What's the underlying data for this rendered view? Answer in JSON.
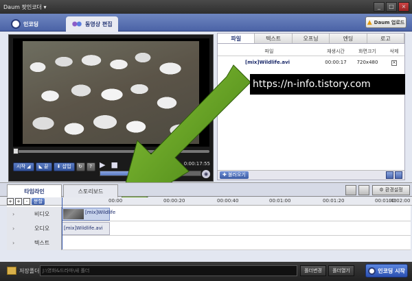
{
  "window": {
    "title": "Daum 팟인코더 ▾"
  },
  "top_tabs": {
    "encode": "인코딩",
    "edit": "동영상 편집"
  },
  "upload_label": "Daum 업로드",
  "player": {
    "start_label": "시작",
    "end_label": "끝",
    "insert_label": "삽입",
    "timecode": "0:00:17:55",
    "volume": 0.55
  },
  "file_panel": {
    "tabs": [
      "파일",
      "텍스트",
      "오프닝",
      "엔딩",
      "로고"
    ],
    "headers": {
      "file": "파일",
      "duration": "재생시간",
      "resolution": "화면크기",
      "delete": "삭제"
    },
    "rows": [
      {
        "file": "[mix]Wildlife.avi",
        "duration": "00:00:17",
        "resolution": "720x480",
        "delete": "×"
      }
    ],
    "load_label": "불러오기"
  },
  "watermark": "https://n-info.tistory.com",
  "timeline": {
    "tabs": {
      "timeline": "타임라인",
      "storyboard": "스토리보드"
    },
    "settings_label": "환경설정",
    "split_label": "분할",
    "ruler": [
      "00:00",
      "00:00:20",
      "00:00:40",
      "00:01:00",
      "00:01:20",
      "00:01:40",
      "00:02:00"
    ],
    "tracks": {
      "video": "비디오",
      "audio": "오디오",
      "text": "텍스트"
    },
    "video_clip": "[mix]Wildlife",
    "audio_clip": "[mix]Wildlife.avi"
  },
  "bottom": {
    "save_folder_label": "저장폴더",
    "path": "J:\\영화&드라마\\새 폴더",
    "change_label": "폴더변경",
    "open_label": "폴더열기",
    "start_encode": "인코딩 시작"
  },
  "colors": {
    "accent": "#4b63a6",
    "arrow": "#5a9a1a"
  }
}
